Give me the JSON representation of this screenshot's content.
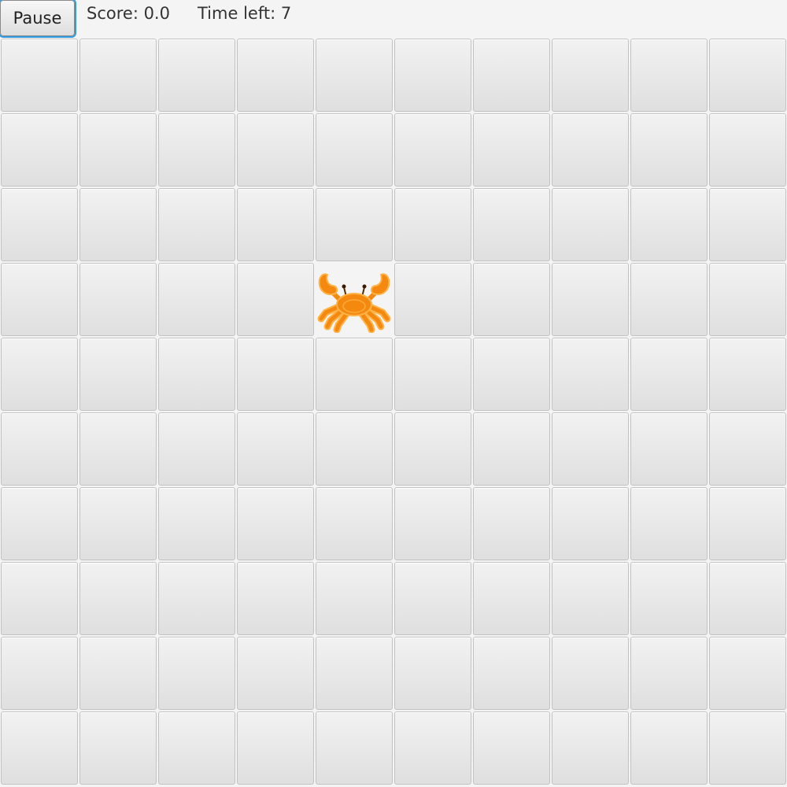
{
  "toolbar": {
    "pause_label": "Pause",
    "score_text": "Score: 0.0",
    "time_text": "Time left: 7"
  },
  "board": {
    "rows": 10,
    "cols": 10,
    "crab": {
      "row": 3,
      "col": 4,
      "icon": "crab-icon"
    }
  },
  "colors": {
    "crab_body": "#f5890f",
    "crab_outline": "#ffb347",
    "focus_ring": "#2f9be3"
  }
}
